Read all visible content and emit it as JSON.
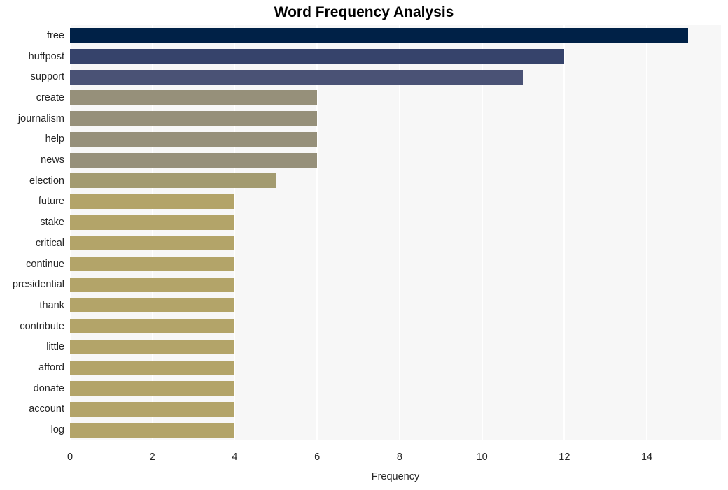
{
  "chart_data": {
    "type": "bar",
    "orientation": "horizontal",
    "title": "Word Frequency Analysis",
    "xlabel": "Frequency",
    "ylabel": "",
    "xlim": [
      0,
      15.8
    ],
    "ylim": [
      0,
      19
    ],
    "grid": "vertical-only",
    "legend": "none",
    "x_ticks": [
      0,
      2,
      4,
      6,
      8,
      10,
      12,
      14
    ],
    "x_tick_labels": [
      "0",
      "2",
      "4",
      "6",
      "8",
      "10",
      "12",
      "14"
    ],
    "categories": [
      "free",
      "huffpost",
      "support",
      "create",
      "journalism",
      "help",
      "news",
      "election",
      "future",
      "stake",
      "critical",
      "continue",
      "presidential",
      "thank",
      "contribute",
      "little",
      "afford",
      "donate",
      "account",
      "log"
    ],
    "values": [
      15,
      12,
      11,
      6,
      6,
      6,
      6,
      5,
      4,
      4,
      4,
      4,
      4,
      4,
      4,
      4,
      4,
      4,
      4,
      4
    ],
    "bar_colors": [
      "#002147",
      "#36436b",
      "#4a5275",
      "#96907a",
      "#96907a",
      "#96907a",
      "#96907a",
      "#a39b70",
      "#b3a469",
      "#b3a469",
      "#b3a469",
      "#b3a469",
      "#b3a469",
      "#b3a469",
      "#b3a469",
      "#b3a469",
      "#b3a469",
      "#b3a469",
      "#b3a469",
      "#b3a469"
    ]
  },
  "style": {
    "plot_background": "#f7f7f7",
    "figure_background": "#ffffff",
    "gridline_color": "#ffffff",
    "text_color": "#262626"
  }
}
